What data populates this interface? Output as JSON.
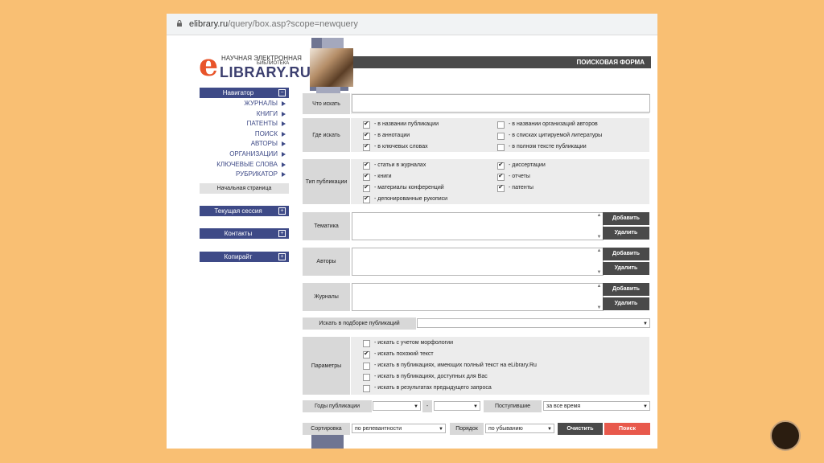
{
  "url": {
    "host": "elibrary.ru",
    "path": "/query/box.asp?scope=newquery"
  },
  "logo": {
    "letter": "e",
    "line1": "НАУЧНАЯ ЭЛЕКТРОННАЯ",
    "line2": "БИБЛИОТЕКА",
    "name": "LIBRARY.RU"
  },
  "header": {
    "title": "ПОИСКОВАЯ ФОРМА"
  },
  "sidebar": {
    "navigator": "Навигатор",
    "items": [
      "ЖУРНАЛЫ",
      "КНИГИ",
      "ПАТЕНТЫ",
      "ПОИСК",
      "АВТОРЫ",
      "ОРГАНИЗАЦИИ",
      "КЛЮЧЕВЫЕ СЛОВА",
      "РУБРИКАТОР"
    ],
    "home": "Начальная страница",
    "session": "Текущая сессия",
    "contacts": "Контакты",
    "copyright": "Копирайт",
    "minus": "−",
    "plus": "+"
  },
  "form": {
    "what_label": "Что искать",
    "where_label": "Где искать",
    "where": [
      {
        "label": "- в названии публикации",
        "checked": true
      },
      {
        "label": "- в аннотации",
        "checked": true
      },
      {
        "label": "- в ключевых словах",
        "checked": true
      },
      {
        "label": "- в названии организаций авторов",
        "checked": false
      },
      {
        "label": "- в списках цитируемой литературы",
        "checked": false
      },
      {
        "label": "- в полном тексте публикации",
        "checked": false
      }
    ],
    "type_label": "Тип публикации",
    "types": [
      {
        "label": "- статьи в журналах",
        "checked": true
      },
      {
        "label": "- книги",
        "checked": true
      },
      {
        "label": "- материалы конференций",
        "checked": true
      },
      {
        "label": "- депонированные рукописи",
        "checked": true
      },
      {
        "label": "- диссертации",
        "checked": true
      },
      {
        "label": "- отчеты",
        "checked": true
      },
      {
        "label": "- патенты",
        "checked": true
      }
    ],
    "topic_label": "Тематика",
    "authors_label": "Авторы",
    "journals_label": "Журналы",
    "add": "Добавить",
    "remove": "Удалить",
    "in_selection_label": "Искать в подборке публикаций",
    "params_label": "Параметры",
    "params": [
      {
        "label": "- искать с учетом морфологии",
        "checked": false
      },
      {
        "label": "- искать похожий текст",
        "checked": true
      },
      {
        "label": "- искать в публикациях, имеющих полный текст на eLibrary.Ru",
        "checked": false
      },
      {
        "label": "- искать в публикациях, доступных для Вас",
        "checked": false
      },
      {
        "label": "- искать в результатах предыдущего запроса",
        "checked": false
      }
    ],
    "years_label": "Годы публикации",
    "dash": "-",
    "received_label": "Поступившие",
    "received_value": "за все время",
    "sort_label": "Сортировка",
    "sort_value": "по релевантности",
    "order_label": "Порядок",
    "order_value": "по убыванию",
    "clear": "Очистить",
    "search": "Поиск"
  },
  "colors": {
    "background": "#f9bf73",
    "accent": "#3e4a87",
    "search_button": "#e8594c",
    "logo": "#e8542a"
  }
}
